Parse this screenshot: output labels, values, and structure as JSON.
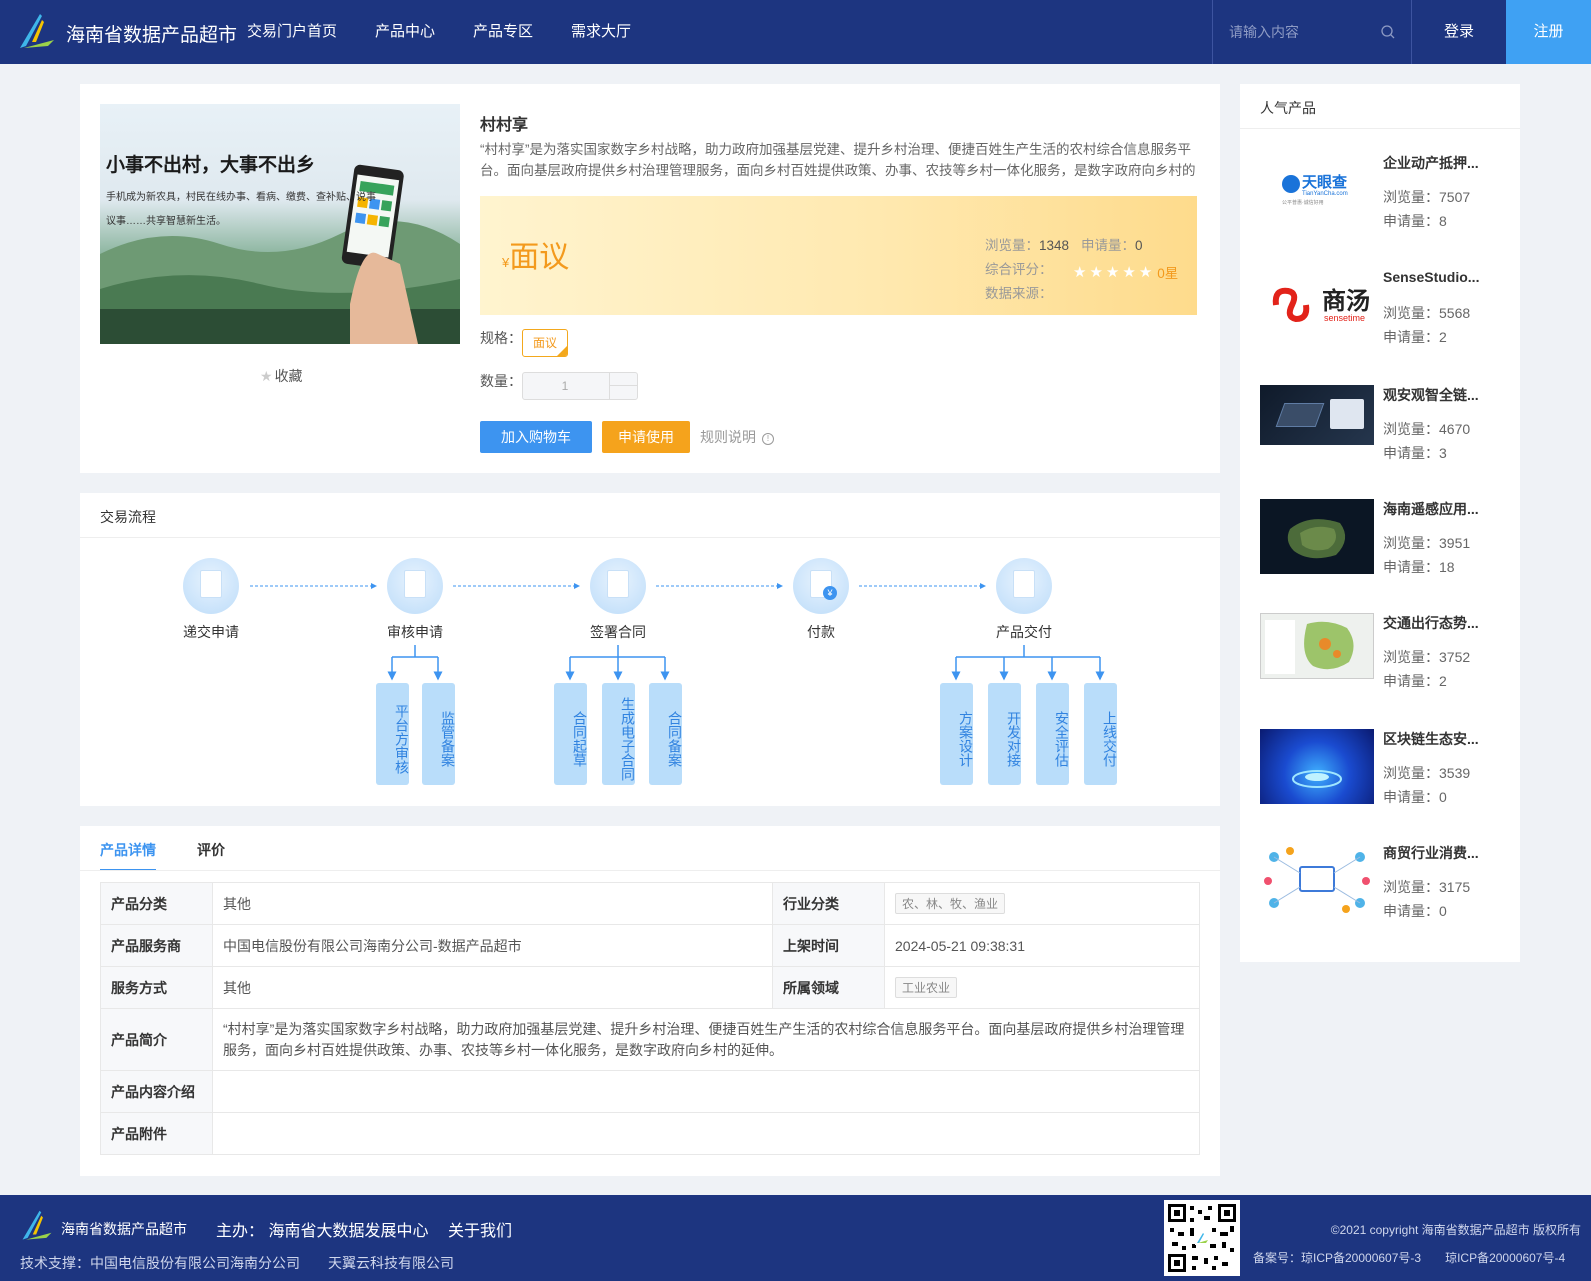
{
  "header": {
    "site_title": "海南省数据产品超市",
    "nav": [
      "交易门户首页",
      "产品中心",
      "产品专区",
      "需求大厅"
    ],
    "search_placeholder": "请输入内容",
    "login": "登录",
    "register": "注册"
  },
  "product": {
    "name": "村村享",
    "description": "“村村享”是为落实国家数字乡村战略，助力政府加强基层党建、提升乡村治理、便捷百姓生产生活的农村综合信息服务平台。面向基层政府提供乡村治理管理服务，面向乡村百姓提供政策、办事、农技等乡村一体化服务，是数字政府向乡村的延伸。",
    "image_text_1": "小事不出村，大事不出乡",
    "image_text_2": "手机成为新农具，村民在线办事、看病、缴费、查补贴、说事",
    "image_text_3": "议事……共享智慧新生活。",
    "favorite": "收藏",
    "price_symbol": "¥",
    "price": "面议",
    "views_label": "浏览量：",
    "views": "1348",
    "applies_label": "申请量：",
    "applies": "0",
    "rating_label": "综合评分：",
    "rating_text": "0星",
    "rating_value": 0,
    "source_label": "数据来源：",
    "spec_label": "规格：",
    "spec_value": "面议",
    "qty_label": "数量：",
    "qty_value": "1",
    "add_cart": "加入购物车",
    "apply_use": "申请使用",
    "rules": "规则说明",
    "rules_icon": "!"
  },
  "flow": {
    "title": "交易流程",
    "steps": [
      "递交申请",
      "审核申请",
      "签署合同",
      "付款",
      "产品交付"
    ],
    "sub_steps": {
      "review": [
        "平台方审核",
        "监管备案"
      ],
      "contract": [
        "合同起草",
        "生成电子合同",
        "合同备案"
      ],
      "delivery": [
        "方案设计",
        "开发对接",
        "安全评估",
        "上线交付"
      ]
    },
    "pay_icon_symbol": "¥"
  },
  "detail": {
    "tabs": [
      "产品详情",
      "评价"
    ],
    "rows": {
      "category_k": "产品分类",
      "category_v": "其他",
      "industry_k": "行业分类",
      "industry_v": "农、林、牧、渔业",
      "provider_k": "产品服务商",
      "provider_v": "中国电信股份有限公司海南分公司-数据产品超市",
      "listed_k": "上架时间",
      "listed_v": "2024-05-21 09:38:31",
      "service_k": "服务方式",
      "service_v": "其他",
      "domain_k": "所属领域",
      "domain_v": "工业农业",
      "intro_k": "产品简介",
      "intro_v": "“村村享”是为落实国家数字乡村战略，助力政府加强基层党建、提升乡村治理、便捷百姓生产生活的农村综合信息服务平台。面向基层政府提供乡村治理管理服务，面向乡村百姓提供政策、办事、农技等乡村一体化服务，是数字政府向乡村的延伸。",
      "content_k": "产品内容介绍",
      "content_v": "",
      "attach_k": "产品附件",
      "attach_v": ""
    }
  },
  "popular": {
    "title": "人气产品",
    "views_label": "浏览量：",
    "applies_label": "申请量：",
    "items": [
      {
        "name": "企业动产抵押...",
        "views": "7507",
        "applies": "8",
        "logo_text": "天眼查",
        "logo_sub": "TianYanCha.com",
        "logo_sub2": "公平普惠·诚信好用"
      },
      {
        "name": "SenseStudio...",
        "views": "5568",
        "applies": "2",
        "logo_text": "商汤",
        "logo_sub": "sensetime"
      },
      {
        "name": "观安观智全链...",
        "views": "4670",
        "applies": "3"
      },
      {
        "name": "海南遥感应用...",
        "views": "3951",
        "applies": "18"
      },
      {
        "name": "交通出行态势...",
        "views": "3752",
        "applies": "2"
      },
      {
        "name": "区块链生态安...",
        "views": "3539",
        "applies": "0"
      },
      {
        "name": "商贸行业消费...",
        "views": "3175",
        "applies": "0"
      }
    ]
  },
  "footer": {
    "site_title": "海南省数据产品超市",
    "host": "主办： 海南省大数据发展中心",
    "about": "关于我们",
    "support": "技术支撑：中国电信股份有限公司海南分公司　　天翼云科技有限公司",
    "copyright": "©2021 copyright 海南省数据产品超市 版权所有",
    "icp": "备案号：琼ICP备20000607号-3　　琼ICP备20000607号-4"
  },
  "colors": {
    "header_bg": "#1d3580",
    "primary": "#3d94f0",
    "accent": "#f5a31c",
    "register_bg": "#3fa1f3"
  }
}
